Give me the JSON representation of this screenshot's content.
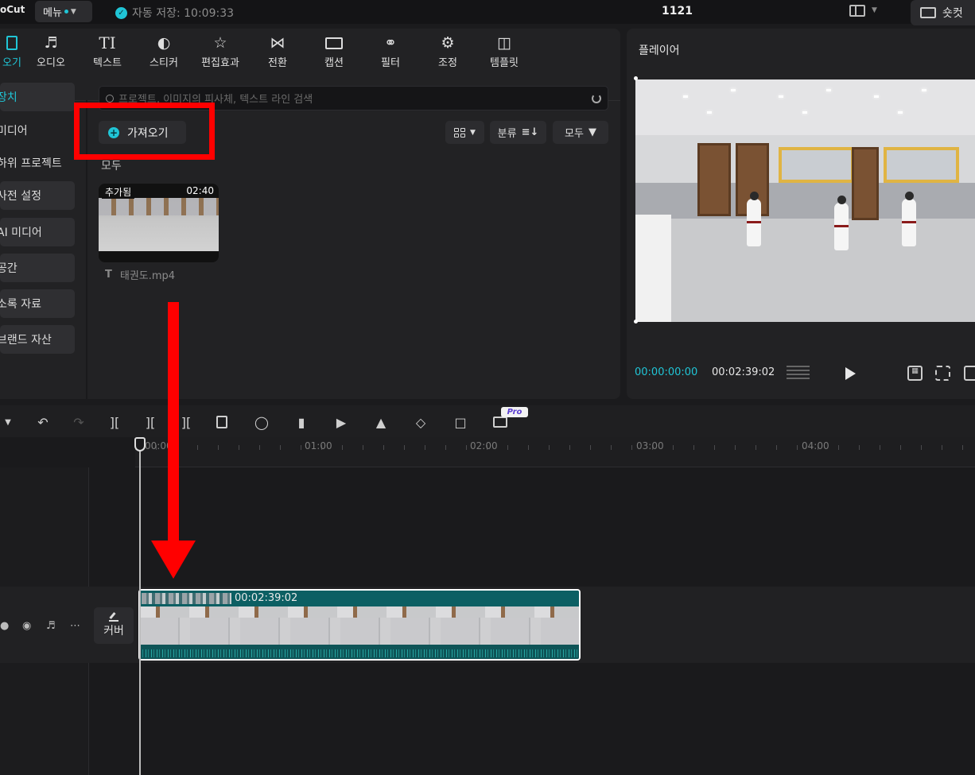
{
  "topbar": {
    "brand": "oCut",
    "menu_label": "메뉴",
    "autosave_text": "자동 저장: 10:09:33",
    "project_title": "1121",
    "shortcut_label": "숏컷"
  },
  "tabs": [
    {
      "label": "오기",
      "icon": "import-icon",
      "active": true
    },
    {
      "label": "오디오",
      "icon": "audio-icon"
    },
    {
      "label": "텍스트",
      "icon": "text-icon"
    },
    {
      "label": "스티커",
      "icon": "sticker-icon"
    },
    {
      "label": "편집효과",
      "icon": "effects-icon"
    },
    {
      "label": "전환",
      "icon": "transition-icon"
    },
    {
      "label": "캡션",
      "icon": "caption-icon"
    },
    {
      "label": "필터",
      "icon": "filter-icon"
    },
    {
      "label": "조정",
      "icon": "adjust-icon"
    },
    {
      "label": "템플릿",
      "icon": "template-icon"
    }
  ],
  "sidebar": {
    "items": [
      {
        "label": "장치"
      },
      {
        "label": "미디어"
      },
      {
        "label": "하위 프로젝트"
      },
      {
        "label": "사전 설정"
      },
      {
        "label": "AI 미디어"
      },
      {
        "label": "공간"
      },
      {
        "label": "소록 자료"
      },
      {
        "label": "브랜드 자산"
      }
    ]
  },
  "media": {
    "search_placeholder": "프로젝트, 이미지의 피사체, 텍스트 라인 검색",
    "import_label": "가져오기",
    "sort_label": "분류",
    "filter_label": "모두",
    "section_label": "모두",
    "item": {
      "badge": "추가됨",
      "duration": "02:40",
      "filename": "태권도.mp4"
    }
  },
  "player": {
    "title": "플레이어",
    "current_time": "00:00:00:00",
    "total_time": "00:02:39:02"
  },
  "timeline": {
    "ruler_labels": [
      "00:00",
      "01:00",
      "02:00",
      "03:00",
      "04:00"
    ],
    "pro_badge": "Pro",
    "cover_label": "커버",
    "clip_duration": "00:02:39:02"
  },
  "colors": {
    "accent": "#20c5d6",
    "annotation_red": "#ff0000"
  }
}
